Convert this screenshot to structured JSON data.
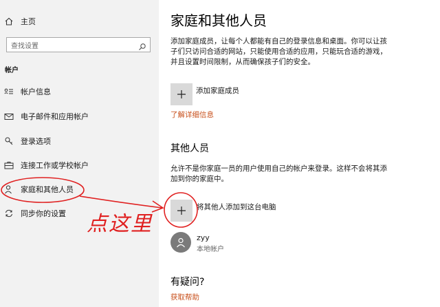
{
  "sidebar": {
    "home_label": "主页",
    "search_placeholder": "查找设置",
    "section_title": "帐户",
    "items": [
      {
        "label": "帐户信息",
        "icon": "account-info-icon"
      },
      {
        "label": "电子邮件和应用帐户",
        "icon": "mail-icon"
      },
      {
        "label": "登录选项",
        "icon": "key-icon"
      },
      {
        "label": "连接工作或学校帐户",
        "icon": "briefcase-icon"
      },
      {
        "label": "家庭和其他人员",
        "icon": "person-icon"
      },
      {
        "label": "同步你的设置",
        "icon": "sync-icon"
      }
    ]
  },
  "main": {
    "title": "家庭和其他人员",
    "family_description": "添加家庭成员，让每个人都能有自己的登录信息和桌面。你可以让孩子们只访问合适的网站，只能使用合适的应用，只能玩合适的游戏，并且设置时间限制，从而确保孩子们的安全。",
    "add_family_label": "添加家庭成员",
    "learn_more_link": "了解详细信息",
    "other_people_title": "其他人员",
    "other_people_description": "允许不是你家庭一员的用户使用自己的帐户来登录。这样不会将其添加到你的家庭中。",
    "add_other_label": "将其他人添加到这台电脑",
    "user": {
      "name": "zyy",
      "type": "本地帐户"
    },
    "help_title": "有疑问?",
    "help_link": "获取帮助"
  },
  "annotation": {
    "text": "点这里",
    "color": "#e02020"
  },
  "colors": {
    "sidebar_bg": "#f2f2f2",
    "link": "#c8501c",
    "tile": "#d9d9d9"
  }
}
